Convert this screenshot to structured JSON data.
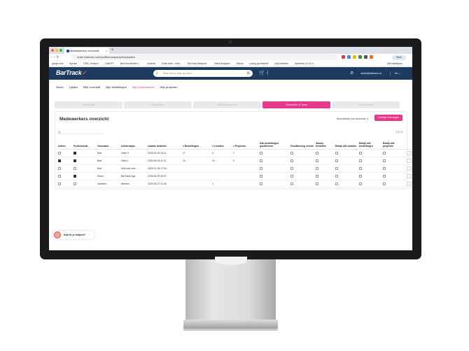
{
  "browser": {
    "tab_title": "Medewerkers overzicht",
    "tab_close": "×",
    "new_tab": "+",
    "url": "order.bartrack.com/profile/company/employees",
    "profile_label": "Werk",
    "all_bookmarks": "Alle bladwijzers",
    "bookmarks": [
      "google mail",
      "Agenda",
      "CRM | Hubspot",
      "ChatGPT",
      "BarTrack Bestllen |...",
      "Leadinfo",
      "Exact bede - onlin...",
      "BarTrack Webportl...",
      "Sales Navigator",
      "Ethnok",
      "pricing groothandel",
      "prijs bestellen",
      "Synthesia | #1 AI V..."
    ],
    "colors": {
      "dot_red": "#ff5f57",
      "dot_yellow": "#febc2e",
      "dot_green": "#28c840"
    },
    "extension_colors": [
      "#e23d3d",
      "#4285f4",
      "#f4b400",
      "#3c8d40",
      "#555555",
      "#e8711a"
    ]
  },
  "header": {
    "logo_main": "BarTrack",
    "logo_mark": "✓",
    "search_placeholder": "Waar ben je naar op zoek?",
    "cart_icon": "shopping-cart-icon",
    "email": "robert@bartrack.nl",
    "language": "NL ⌄",
    "colors": {
      "bar": "#1d3a5f",
      "accent": "#ee3f93"
    }
  },
  "nav": {
    "items": [
      "Home",
      "Lijstjes",
      "Mijn voorraad",
      "Mijn bestellingen",
      "Mijn groothandels",
      "Mijn projecten"
    ],
    "active_index": 4
  },
  "steps": {
    "items": [
      "Persoonlijk",
      "Organisatie",
      "Bedrijfsgegevens",
      "Gebruikers & Team",
      "Abonnement"
    ],
    "active_index": 3
  },
  "card": {
    "title": "Medewerkers overzicht",
    "accounts_label": "Beschikbare pro accounts: 4",
    "save_label": "Collega Toevoegen",
    "filter_placeholder": "Q",
    "pager": "1-5 / 5",
    "columns": [
      "Admin",
      "Professional",
      "Voornaam",
      "Achternaam",
      "Laatste activiteit",
      "# Bestellingen",
      "# Locaties",
      "# Projecten",
      "Kan bestellingen goedkeuren",
      "Goedkeuring vereist",
      "Samen bestellen",
      "Bekijk alle locaties",
      "Bekijk alle bestellingen",
      "Bekijk alle projecten",
      ""
    ],
    "rows": [
      {
        "admin": false,
        "pro": true,
        "first": "Bart",
        "last": "Gelst II",
        "activity": "2025-03-29 15:11",
        "orders": "17",
        "locations": "3",
        "projects": "1",
        "c1": false,
        "c2": false,
        "c3": false,
        "c4": false,
        "c5": false,
        "c6": false
      },
      {
        "admin": true,
        "pro": true,
        "first": "Bart",
        "last": "Gelst 1",
        "activity": "2025-05-15 11:37",
        "orders": "23",
        "locations": "10",
        "projects": "3",
        "c1": false,
        "c2": false,
        "c3": false,
        "c4": false,
        "c5": false,
        "c6": false
      },
      {
        "admin": false,
        "pro": false,
        "first": "Bart",
        "last": "Hulli user test",
        "activity": "2025-01-08 17:34",
        "orders": "",
        "locations": "",
        "projects": "",
        "c1": false,
        "c2": false,
        "c3": false,
        "c4": false,
        "c5": false,
        "c6": false
      },
      {
        "admin": false,
        "pro": true,
        "first": "Demo",
        "last": "BarTrack App",
        "activity": "2025-05-09 09:57",
        "orders": "",
        "locations": "",
        "projects": "",
        "c1": false,
        "c2": false,
        "c3": false,
        "c4": false,
        "c5": false,
        "c6": false
      },
      {
        "admin": false,
        "pro": false,
        "first": "Vanbeen",
        "last": "Werther",
        "activity": "2025-06-07 11:08",
        "orders": "",
        "locations": "1",
        "projects": "",
        "c1": false,
        "c2": false,
        "c3": false,
        "c4": false,
        "c5": false,
        "c6": false
      }
    ],
    "row_action": "›"
  },
  "chat": {
    "label": "Kan ik je helpen?"
  }
}
